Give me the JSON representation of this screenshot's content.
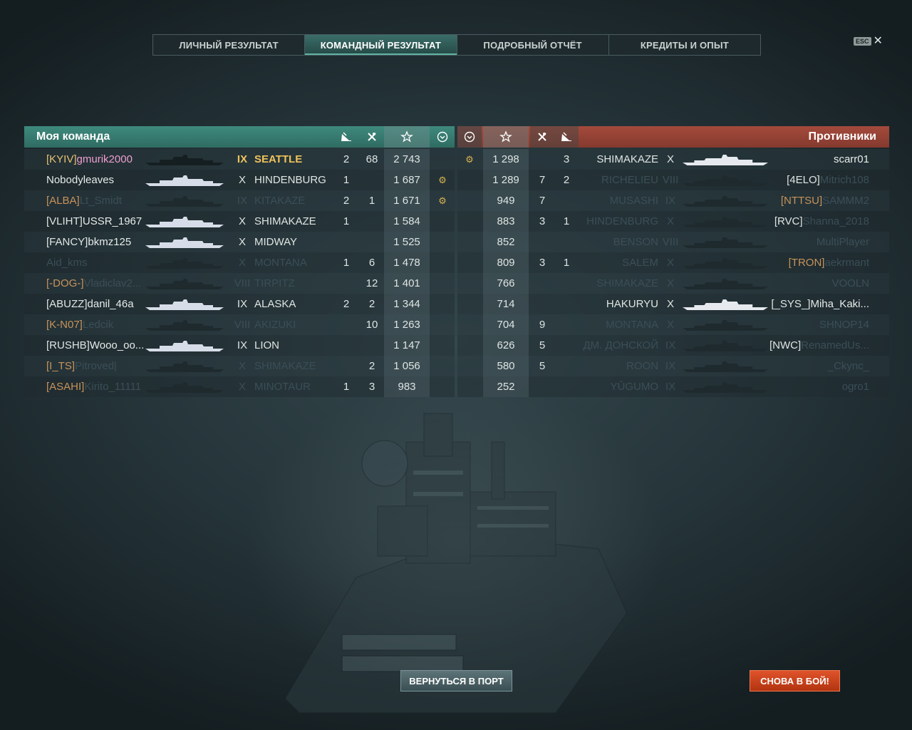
{
  "tabs": [
    {
      "label": "ЛИЧНЫЙ РЕЗУЛЬТАТ",
      "active": false
    },
    {
      "label": "КОМАНДНЫЙ РЕЗУЛЬТАТ",
      "active": true
    },
    {
      "label": "ПОДРОБНЫЙ ОТЧЁТ",
      "active": false
    },
    {
      "label": "КРЕДИТЫ И ОПЫТ",
      "active": false
    }
  ],
  "esc": {
    "key": "ESC",
    "close": "✕"
  },
  "my_team": {
    "title": "Моя команда",
    "columns_icons": [
      "ships-destroyed-icon",
      "planes-destroyed-icon",
      "base-xp-star-icon",
      "medal-icon"
    ],
    "rows": [
      {
        "clan": "[KYIV]",
        "name": "gmurik2000",
        "tier": "IX",
        "ship": "SEATTLE",
        "kills": "2",
        "planes": "68",
        "xp": "2 743",
        "medal": "",
        "state": "self"
      },
      {
        "clan": "",
        "name": "Nobodyleaves",
        "tier": "X",
        "ship": "HINDENBURG",
        "kills": "1",
        "planes": "",
        "xp": "1 687",
        "medal": "⚙",
        "state": "alive"
      },
      {
        "clan": "[ALBA]",
        "name": "Lt_Smidt",
        "tier": "IX",
        "ship": "KITAKAZE",
        "kills": "2",
        "planes": "1",
        "xp": "1 671",
        "medal": "⚙",
        "state": "dead"
      },
      {
        "clan": "[VLIHT]",
        "name": "USSR_1967",
        "tier": "X",
        "ship": "SHIMAKAZE",
        "kills": "1",
        "planes": "",
        "xp": "1 584",
        "medal": "",
        "state": "alive"
      },
      {
        "clan": "[FANCY]",
        "name": "bkmz125",
        "tier": "X",
        "ship": "MIDWAY",
        "kills": "",
        "planes": "",
        "xp": "1 525",
        "medal": "",
        "state": "alive"
      },
      {
        "clan": "",
        "name": "Aid_kms",
        "tier": "X",
        "ship": "MONTANA",
        "kills": "1",
        "planes": "6",
        "xp": "1 478",
        "medal": "",
        "state": "dead"
      },
      {
        "clan": "[-DOG-]",
        "name": "Vladiclav2...",
        "tier": "VIII",
        "ship": "TIRPITZ",
        "kills": "",
        "planes": "12",
        "xp": "1 401",
        "medal": "",
        "state": "dead"
      },
      {
        "clan": "[ABUZZ]",
        "name": "danil_46a",
        "tier": "IX",
        "ship": "ALASKA",
        "kills": "2",
        "planes": "2",
        "xp": "1 344",
        "medal": "",
        "state": "alive"
      },
      {
        "clan": "[K-N07]",
        "name": "Ledcik",
        "tier": "VIII",
        "ship": "AKIZUKI",
        "kills": "",
        "planes": "10",
        "xp": "1 263",
        "medal": "",
        "state": "dead"
      },
      {
        "clan": "[RUSHB]",
        "name": "Wooo_oo...",
        "tier": "IX",
        "ship": "LION",
        "kills": "",
        "planes": "",
        "xp": "1 147",
        "medal": "",
        "state": "alive"
      },
      {
        "clan": "[I_TS]",
        "name": "Pitroved|",
        "tier": "X",
        "ship": "SHIMAKAZE",
        "kills": "",
        "planes": "2",
        "xp": "1 056",
        "medal": "",
        "state": "dead"
      },
      {
        "clan": "[ASAHI]",
        "name": "Kirito_11111",
        "tier": "X",
        "ship": "MINOTAUR",
        "kills": "1",
        "planes": "3",
        "xp": "983",
        "medal": "",
        "state": "dead"
      }
    ]
  },
  "enemy_team": {
    "title": "Противники",
    "rows": [
      {
        "medal": "⚙",
        "xp": "1 298",
        "planes": "",
        "kills": "3",
        "ship": "SHIMAKAZE",
        "tier": "X",
        "clan": "",
        "name": "scarr01",
        "state": "alive"
      },
      {
        "medal": "",
        "xp": "1 289",
        "planes": "7",
        "kills": "2",
        "ship": "RICHELIEU",
        "tier": "VIII",
        "clan": "[4ELO]",
        "name": "Mitrich108",
        "state": "dead"
      },
      {
        "medal": "",
        "xp": "949",
        "planes": "7",
        "kills": "",
        "ship": "MUSASHI",
        "tier": "IX",
        "clan": "[NTTSU]",
        "name": "SAMMM2",
        "state": "dead"
      },
      {
        "medal": "",
        "xp": "883",
        "planes": "3",
        "kills": "1",
        "ship": "HINDENBURG",
        "tier": "X",
        "clan": "[RVC]",
        "name": "Shanna_2018",
        "state": "dead"
      },
      {
        "medal": "",
        "xp": "852",
        "planes": "",
        "kills": "",
        "ship": "BENSON",
        "tier": "VIII",
        "clan": "",
        "name": "MultiPlayer",
        "state": "dead"
      },
      {
        "medal": "",
        "xp": "809",
        "planes": "3",
        "kills": "1",
        "ship": "SALEM",
        "tier": "X",
        "clan": "[TRON]",
        "name": "aekrmant",
        "state": "dead"
      },
      {
        "medal": "",
        "xp": "766",
        "planes": "",
        "kills": "",
        "ship": "SHIMAKAZE",
        "tier": "X",
        "clan": "",
        "name": "VOOLN",
        "state": "dead"
      },
      {
        "medal": "",
        "xp": "714",
        "planes": "",
        "kills": "",
        "ship": "HAKURYU",
        "tier": "X",
        "clan": "[_SYS_]",
        "name": "Miha_Kaki...",
        "state": "alive"
      },
      {
        "medal": "",
        "xp": "704",
        "planes": "9",
        "kills": "",
        "ship": "MONTANA",
        "tier": "X",
        "clan": "",
        "name": "SHNOP14",
        "state": "dead"
      },
      {
        "medal": "",
        "xp": "626",
        "planes": "5",
        "kills": "",
        "ship": "ДМ. ДОНСКОЙ",
        "tier": "IX",
        "clan": "[NWC]",
        "name": "RenamedUs...",
        "state": "dead"
      },
      {
        "medal": "",
        "xp": "580",
        "planes": "5",
        "kills": "",
        "ship": "ROON",
        "tier": "IX",
        "clan": "",
        "name": "_Ckync_",
        "state": "dead"
      },
      {
        "medal": "",
        "xp": "252",
        "planes": "",
        "kills": "",
        "ship": "YŪGUMO",
        "tier": "IX",
        "clan": "",
        "name": "ogro1",
        "state": "dead"
      }
    ]
  },
  "buttons": {
    "port": "ВЕРНУТЬСЯ В ПОРТ",
    "battle": "СНОВА В БОЙ!"
  },
  "colors": {
    "ally_header": "#3f8a7d",
    "enemy_header": "#a44a3c",
    "accent_gold": "#f0c35a",
    "battle_button": "#e0532a"
  }
}
